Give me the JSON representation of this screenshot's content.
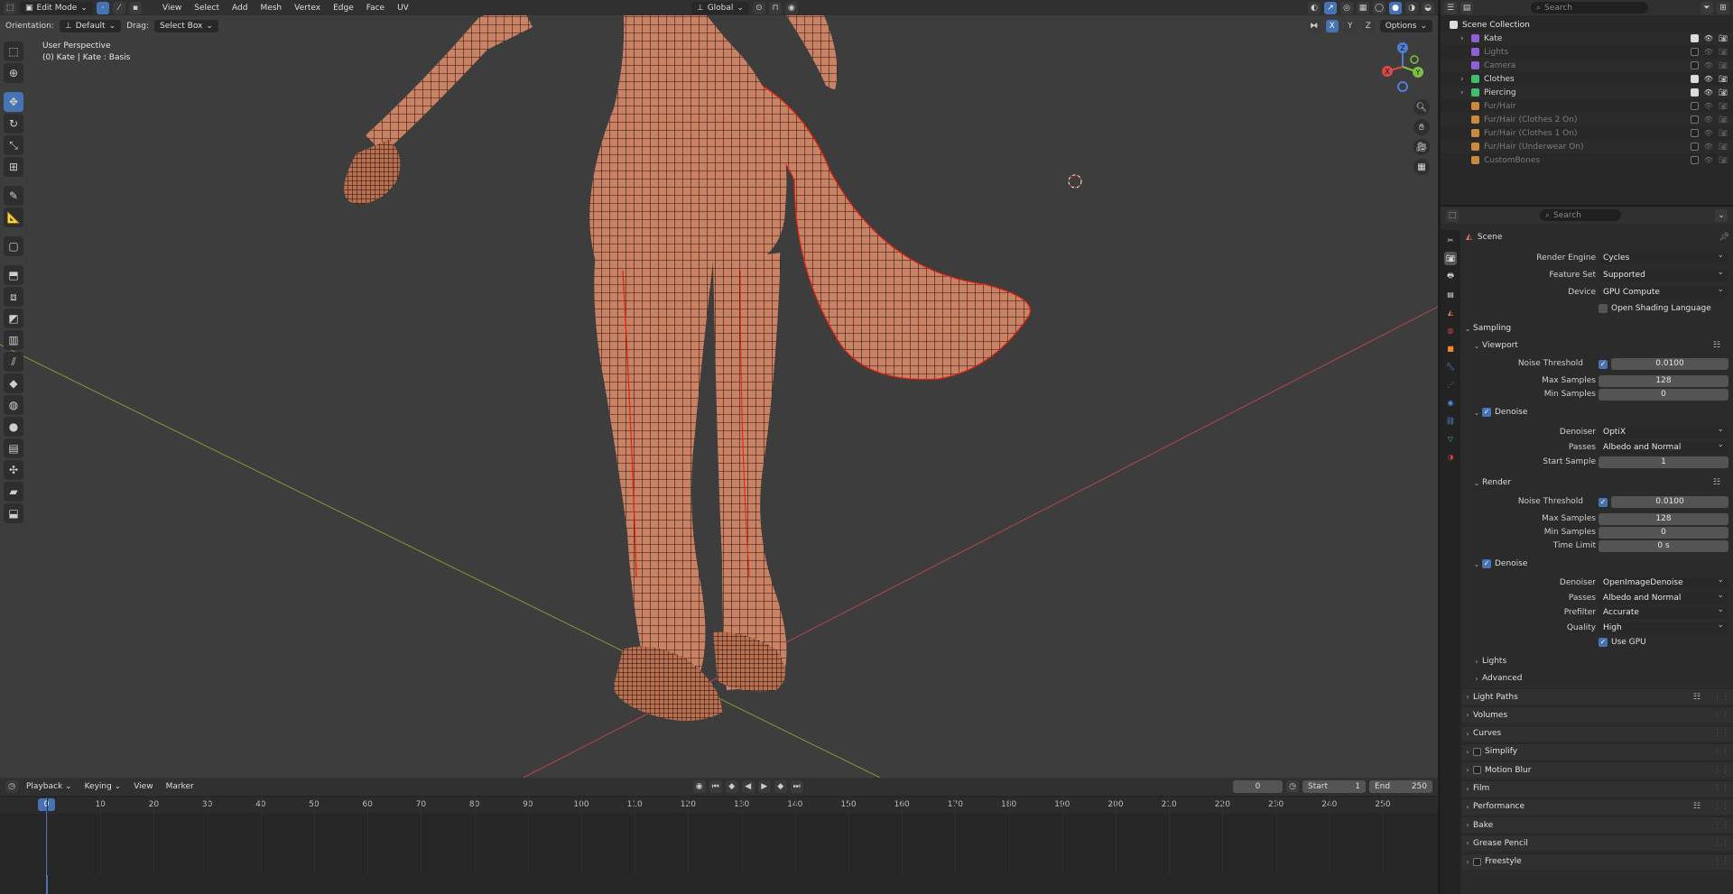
{
  "viewport": {
    "mode": "Edit Mode",
    "menus": [
      "View",
      "Select",
      "Add",
      "Mesh",
      "Vertex",
      "Edge",
      "Face",
      "UV"
    ],
    "transform_orientation": "Global",
    "options_label": "Options",
    "orientation_label": "Orientation:",
    "orientation_value": "Default",
    "drag_label": "Drag:",
    "drag_value": "Select Box",
    "axes": [
      "X",
      "Y",
      "Z"
    ],
    "info_line1": "User Perspective",
    "info_line2": "(0) Kate | Kate : Basis",
    "gizmo": {
      "x": "X",
      "y": "Y",
      "z": "Z"
    },
    "colors": {
      "mesh": "#c98263",
      "seam": "#e02010",
      "x_axis": "#b5464b",
      "y_axis": "#7e9a36"
    }
  },
  "timeline": {
    "menus": [
      "Playback",
      "Keying",
      "View",
      "Marker"
    ],
    "current_frame": "0",
    "start_label": "Start",
    "start_value": "1",
    "end_label": "End",
    "end_value": "250",
    "ticks": [
      "0",
      "10",
      "20",
      "30",
      "40",
      "50",
      "60",
      "70",
      "80",
      "90",
      "100",
      "110",
      "120",
      "130",
      "140",
      "150",
      "160",
      "170",
      "180",
      "190",
      "200",
      "210",
      "220",
      "230",
      "240",
      "250"
    ]
  },
  "outliner": {
    "search_placeholder": "Search",
    "root": "Scene Collection",
    "items": [
      {
        "name": "Kate",
        "color": "#8f5fd6",
        "dim": false,
        "expand": true
      },
      {
        "name": "Lights",
        "color": "#8f5fd6",
        "dim": true,
        "expand": false
      },
      {
        "name": "Camera",
        "color": "#8f5fd6",
        "dim": true,
        "expand": false
      },
      {
        "name": "Clothes",
        "color": "#3fbf6a",
        "dim": false,
        "expand": true
      },
      {
        "name": "Piercing",
        "color": "#3fbf6a",
        "dim": false,
        "expand": true
      },
      {
        "name": "Fur/Hair",
        "color": "#c98a3d",
        "dim": true,
        "expand": false
      },
      {
        "name": "Fur/Hair (Clothes 2 On)",
        "color": "#c98a3d",
        "dim": true,
        "expand": false
      },
      {
        "name": "Fur/Hair (Clothes 1 On)",
        "color": "#c98a3d",
        "dim": true,
        "expand": false
      },
      {
        "name": "Fur/Hair (Underwear On)",
        "color": "#c98a3d",
        "dim": true,
        "expand": false
      },
      {
        "name": "CustomBones",
        "color": "#c98a3d",
        "dim": true,
        "expand": false
      }
    ]
  },
  "properties": {
    "search_placeholder": "Search",
    "context": "Scene",
    "render_engine_label": "Render Engine",
    "render_engine": "Cycles",
    "feature_set_label": "Feature Set",
    "feature_set": "Supported",
    "device_label": "Device",
    "device": "GPU Compute",
    "osl_label": "Open Shading Language",
    "sampling": "Sampling",
    "viewport_sub": "Viewport",
    "noise_threshold_label": "Noise Threshold",
    "vp_noise_threshold": "0.0100",
    "max_samples_label": "Max Samples",
    "vp_max_samples": "128",
    "min_samples_label": "Min Samples",
    "vp_min_samples": "0",
    "denoise_label": "Denoise",
    "denoiser_label": "Denoiser",
    "vp_denoiser": "OptiX",
    "passes_label": "Passes",
    "vp_passes": "Albedo and Normal",
    "start_sample_label": "Start Sample",
    "vp_start_sample": "1",
    "render_sub": "Render",
    "r_noise_threshold": "0.0100",
    "r_max_samples": "128",
    "r_min_samples": "0",
    "time_limit_label": "Time Limit",
    "r_time_limit": "0 s",
    "r_denoiser": "OpenImageDenoise",
    "r_passes": "Albedo and Normal",
    "prefilter_label": "Prefilter",
    "r_prefilter": "Accurate",
    "quality_label": "Quality",
    "r_quality": "High",
    "use_gpu_label": "Use GPU",
    "lights_sub": "Lights",
    "advanced_sub": "Advanced",
    "panels": [
      "Light Paths",
      "Volumes",
      "Curves",
      "Simplify",
      "Motion Blur",
      "Film",
      "Performance",
      "Bake",
      "Grease Pencil",
      "Freestyle"
    ]
  }
}
